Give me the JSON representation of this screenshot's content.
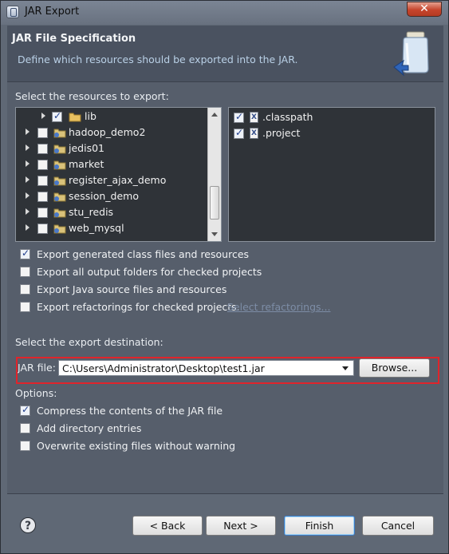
{
  "window": {
    "title": "JAR Export",
    "close_glyph": "✕"
  },
  "header": {
    "title": "JAR File Specification",
    "description": "Define which resources should be exported into the JAR.",
    "icon": "jar-icon"
  },
  "resources": {
    "label": "Select the resources to export:",
    "tree": [
      {
        "label": "lib",
        "checked": true,
        "icon": "folder-icon"
      },
      {
        "label": "hadoop_demo2",
        "checked": false,
        "icon": "project-icon"
      },
      {
        "label": "jedis01",
        "checked": false,
        "icon": "project-icon"
      },
      {
        "label": "market",
        "checked": false,
        "icon": "project-icon"
      },
      {
        "label": "register_ajax_demo",
        "checked": false,
        "icon": "project-icon"
      },
      {
        "label": "session_demo",
        "checked": false,
        "icon": "project-icon"
      },
      {
        "label": "stu_redis",
        "checked": false,
        "icon": "project-icon"
      },
      {
        "label": "web_mysql",
        "checked": false,
        "icon": "project-icon"
      }
    ],
    "files": [
      {
        "label": ".classpath",
        "checked": true,
        "icon": "xml-file-icon"
      },
      {
        "label": ".project",
        "checked": true,
        "icon": "xml-file-icon"
      }
    ]
  },
  "export_options": [
    {
      "label": "Export generated class files and resources",
      "checked": true
    },
    {
      "label": "Export all output folders for checked projects",
      "checked": false
    },
    {
      "label": "Export Java source files and resources",
      "checked": false
    },
    {
      "label": "Export refactorings for checked projects.",
      "checked": false
    }
  ],
  "select_refactorings_link": "Select refactorings...",
  "destination": {
    "label": "Select the export destination:",
    "jar_file_label": "JAR file:",
    "jar_file_value": "C:\\Users\\Administrator\\Desktop\\test1.jar",
    "browse_label": "Browse..."
  },
  "options": {
    "label": "Options:",
    "items": [
      {
        "label": "Compress the contents of the JAR file",
        "checked": true
      },
      {
        "label": "Add directory entries",
        "checked": false
      },
      {
        "label": "Overwrite existing files without warning",
        "checked": false
      }
    ]
  },
  "buttons": {
    "help": "?",
    "back": "< Back",
    "next": "Next >",
    "finish": "Finish",
    "cancel": "Cancel"
  },
  "colors": {
    "highlight_border": "#e0242b",
    "tree_background": "#2f3338",
    "link": "#7d8da6"
  }
}
